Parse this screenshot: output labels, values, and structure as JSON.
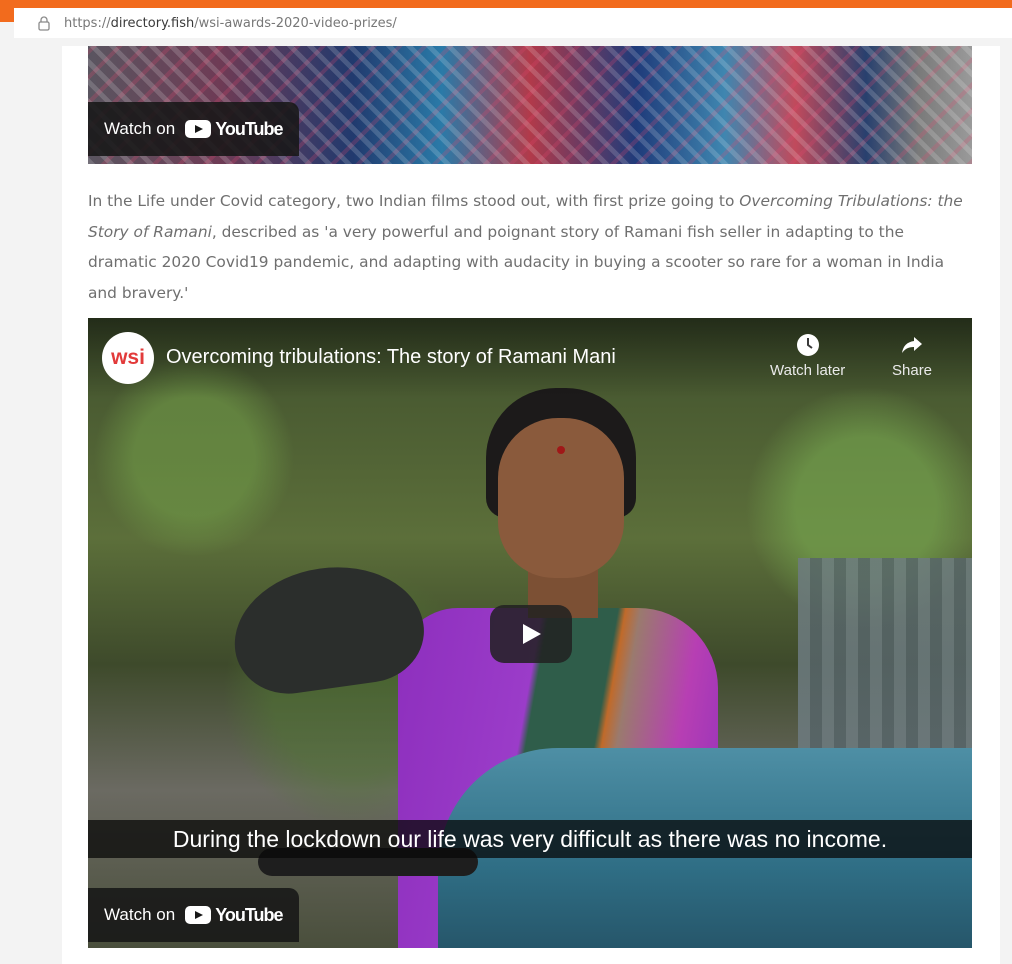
{
  "browser": {
    "url_prefix": "https://",
    "url_domain": "directory.fish",
    "url_path": "/wsi-awards-2020-video-prizes/"
  },
  "video_top": {
    "watch_on": "Watch on",
    "youtube_label": "YouTube"
  },
  "article": {
    "p1_part1": "In the Life under Covid category, two Indian films stood out, with first prize going to ",
    "p1_italic": "Overcoming Tribulations: the Story of Ramani",
    "p1_part2": ", described as 'a very powerful and poignant story of Ramani fish seller in adapting to the dramatic 2020 Covid19 pandemic, and adapting with audacity in buying a scooter so rare for a woman in India and bravery.'"
  },
  "video_main": {
    "channel_initials": "wsi",
    "title": "Overcoming tribulations: The story of Ramani Mani",
    "watch_later_label": "Watch later",
    "share_label": "Share",
    "caption": "During the lockdown our life was very difficult as there was no income.",
    "watch_on": "Watch on",
    "youtube_label": "YouTube"
  },
  "colors": {
    "accent_orange": "#f26b1d",
    "youtube_red": "#ff0000",
    "channel_red": "#e23a3a"
  }
}
